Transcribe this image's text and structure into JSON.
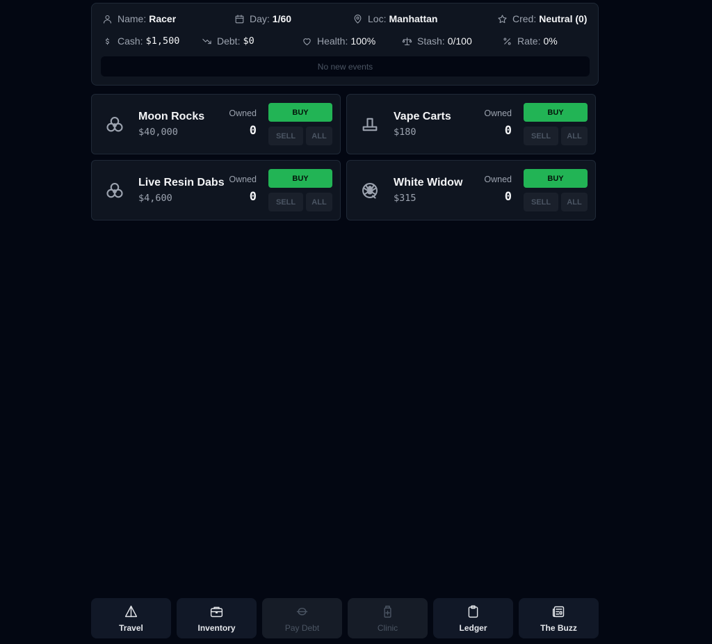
{
  "status": {
    "name": {
      "label": "Name:",
      "value": "Racer"
    },
    "day": {
      "label": "Day:",
      "value": "1/60"
    },
    "loc": {
      "label": "Loc:",
      "value": "Manhattan"
    },
    "cred": {
      "label": "Cred:",
      "value": "Neutral (0)"
    },
    "cash": {
      "label": "Cash:",
      "value": "$1,500"
    },
    "debt": {
      "label": "Debt:",
      "value": "$0"
    },
    "health": {
      "label": "Health:",
      "value": "100%"
    },
    "stash": {
      "label": "Stash:",
      "value": "0/100"
    },
    "rate": {
      "label": "Rate:",
      "value": "0%"
    },
    "events": "No new events"
  },
  "products": [
    {
      "name": "Moon Rocks",
      "price": "$40,000",
      "owned_label": "Owned",
      "owned": "0",
      "buy": "BUY",
      "sell": "SELL",
      "all": "ALL",
      "icon": "biohazard-icon"
    },
    {
      "name": "Vape Carts",
      "price": "$180",
      "owned_label": "Owned",
      "owned": "0",
      "buy": "BUY",
      "sell": "SELL",
      "all": "ALL",
      "icon": "vape-icon"
    },
    {
      "name": "Live Resin Dabs",
      "price": "$4,600",
      "owned_label": "Owned",
      "owned": "0",
      "buy": "BUY",
      "sell": "SELL",
      "all": "ALL",
      "icon": "biohazard-icon"
    },
    {
      "name": "White Widow",
      "price": "$315",
      "owned_label": "Owned",
      "owned": "0",
      "buy": "BUY",
      "sell": "SELL",
      "all": "ALL",
      "icon": "spider-icon"
    }
  ],
  "nav": [
    {
      "label": "Travel",
      "icon": "travel-icon",
      "state": "active"
    },
    {
      "label": "Inventory",
      "icon": "briefcase-icon",
      "state": "active"
    },
    {
      "label": "Pay Debt",
      "icon": "pay-debt-icon",
      "state": "disabled"
    },
    {
      "label": "Clinic",
      "icon": "clinic-icon",
      "state": "disabled"
    },
    {
      "label": "Ledger",
      "icon": "clipboard-icon",
      "state": "active"
    },
    {
      "label": "The Buzz",
      "icon": "newspaper-icon",
      "state": "active"
    }
  ],
  "colors": {
    "background": "#030712",
    "panel": "#0f1520",
    "buy": "#22b455",
    "text": "#f3f4f6",
    "muted": "#9ca3af",
    "disabled": "#4b5563"
  }
}
